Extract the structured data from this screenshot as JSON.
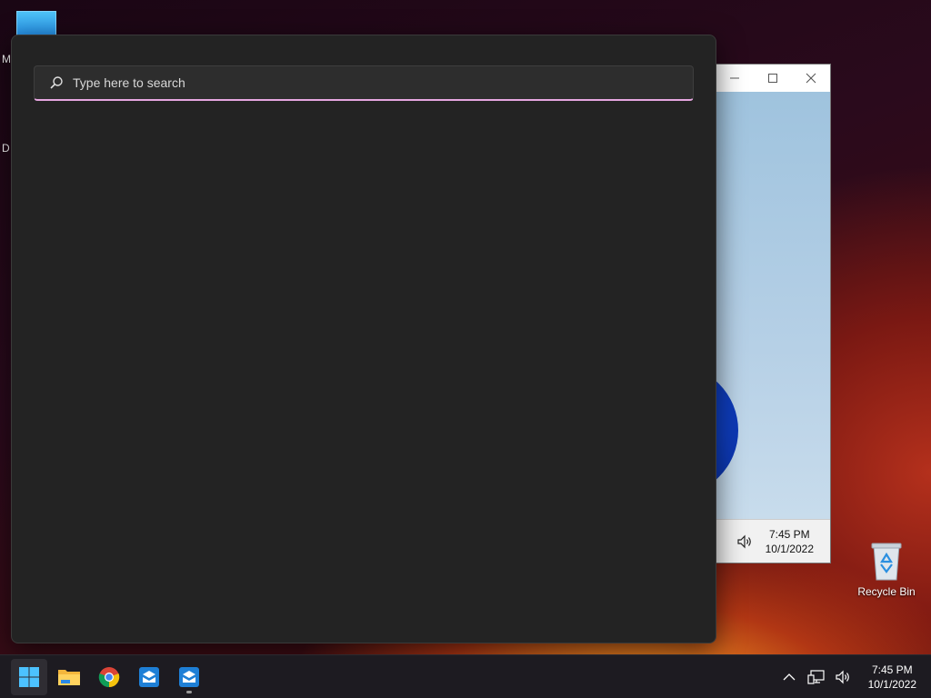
{
  "desktop": {
    "fragments": [
      "M",
      "D"
    ],
    "recycle_bin_label": "Recycle Bin"
  },
  "background_window": {
    "title_buttons": [
      "minimize",
      "maximize",
      "close"
    ],
    "tray_time": "7:45 PM",
    "tray_date": "10/1/2022"
  },
  "search_panel": {
    "search_placeholder": "Type here to search"
  },
  "taskbar": {
    "apps": [
      {
        "name": "start",
        "icon": "windows-logo-icon",
        "active": true
      },
      {
        "name": "file-explorer",
        "icon": "folder-icon"
      },
      {
        "name": "chrome",
        "icon": "chrome-icon"
      },
      {
        "name": "app-1",
        "icon": "box-app-icon"
      },
      {
        "name": "app-2",
        "icon": "box-app-icon",
        "running": true
      }
    ],
    "tray": {
      "time": "7:45 PM",
      "date": "10/1/2022",
      "icons": [
        "chevron-up-icon",
        "network-icon",
        "volume-icon"
      ]
    }
  },
  "colors": {
    "search_accent": "#e5a6e0",
    "panel_bg": "#232323",
    "taskbar_bg": "#1d1b21"
  }
}
